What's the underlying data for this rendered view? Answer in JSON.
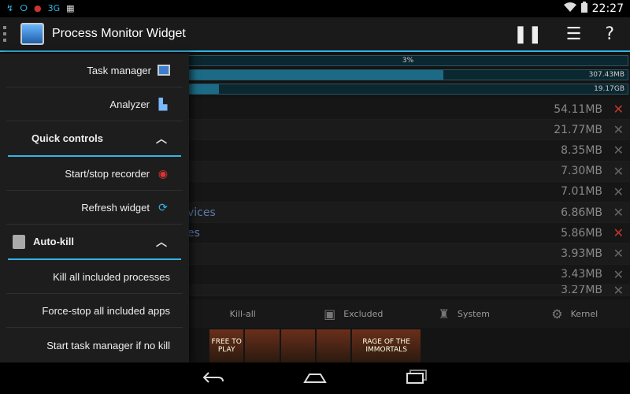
{
  "status_bar": {
    "left_icons": [
      "hotspot-icon",
      "voicemail-icon",
      "record-icon",
      "3g-icon",
      "barcode-icon"
    ],
    "left_glyphs": [
      "↯",
      "ⵔ",
      "●",
      "3G",
      "▦"
    ],
    "time": "22:27"
  },
  "action_bar": {
    "title": "Process Monitor Widget",
    "actions": [
      {
        "icon": "pause-icon",
        "glyph": "❚❚"
      },
      {
        "icon": "settings-sliders-icon",
        "glyph": "☰"
      },
      {
        "icon": "help-icon",
        "glyph": "?"
      }
    ]
  },
  "summary_bars": [
    {
      "center_text": "3%",
      "right_text": "",
      "fill": 0.0
    },
    {
      "center_text": "",
      "right_text": "307.43MB",
      "fill": 0.58
    },
    {
      "center_text": "",
      "right_text": "19.17GB",
      "fill": 0.07
    }
  ],
  "processes": [
    {
      "name": "",
      "memory": "54.11MB",
      "kill_red": true
    },
    {
      "name": "",
      "memory": "21.77MB",
      "kill_red": false
    },
    {
      "name": "",
      "memory": "8.35MB",
      "kill_red": false
    },
    {
      "name": "",
      "memory": "7.30MB",
      "kill_red": false
    },
    {
      "name": "",
      "memory": "7.01MB",
      "kill_red": false
    },
    {
      "name": "vices",
      "memory": "6.86MB",
      "kill_red": false
    },
    {
      "name": "es",
      "memory": "5.86MB",
      "kill_red": true
    },
    {
      "name": "",
      "memory": "3.93MB",
      "kill_red": false
    },
    {
      "name": "",
      "memory": "3.43MB",
      "kill_red": false
    },
    {
      "name": "",
      "memory": "3.27MB",
      "kill_red": false
    }
  ],
  "bottom_tabs": [
    {
      "label": "Kill-all",
      "icon": "kill-all-icon",
      "glyph": ""
    },
    {
      "label": "Excluded",
      "icon": "excluded-icon",
      "glyph": "▣"
    },
    {
      "label": "System",
      "icon": "android-icon",
      "glyph": "♜"
    },
    {
      "label": "Kernel",
      "icon": "kernel-icon",
      "glyph": "⚙"
    }
  ],
  "ad_strip": {
    "items": [
      "FREE TO PLAY",
      "",
      "",
      "",
      "RAGE OF THE IMMORTALS"
    ]
  },
  "drawer": {
    "task_manager": "Task manager",
    "analyzer": "Analyzer",
    "quick_controls": "Quick controls",
    "start_stop_recorder": "Start/stop recorder",
    "refresh_widget": "Refresh widget",
    "auto_kill": "Auto-kill",
    "kill_all_included": "Kill all included processes",
    "force_stop_all": "Force-stop all included apps",
    "start_task_manager": "Start task manager if no kill"
  },
  "colors": {
    "accent": "#33b5e5",
    "kill_red": "#c0392b"
  }
}
